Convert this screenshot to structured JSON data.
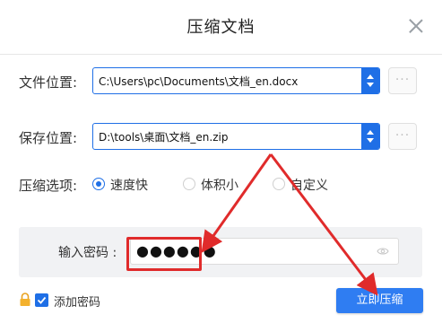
{
  "dialog": {
    "title": "压缩文档"
  },
  "file_location": {
    "label": "文件位置:",
    "value": "C:\\Users\\pc\\Documents\\文档_en.docx",
    "more_label": "···"
  },
  "save_location": {
    "label": "保存位置:",
    "value": "D:\\tools\\桌面\\文档_en.zip",
    "more_label": "···"
  },
  "compression": {
    "label": "压缩选项:",
    "options": [
      {
        "label": "速度快",
        "selected": true
      },
      {
        "label": "体积小",
        "selected": false
      },
      {
        "label": "自定义",
        "selected": false
      }
    ]
  },
  "password": {
    "label": "输入密码 :",
    "masked_value": "●●●●●●"
  },
  "add_password": {
    "label": "添加密码",
    "checked": true
  },
  "actions": {
    "compress_label": "立即压缩"
  },
  "colors": {
    "accent": "#1f6fe6",
    "button": "#2f7df2",
    "annotation": "#e02b2b"
  }
}
